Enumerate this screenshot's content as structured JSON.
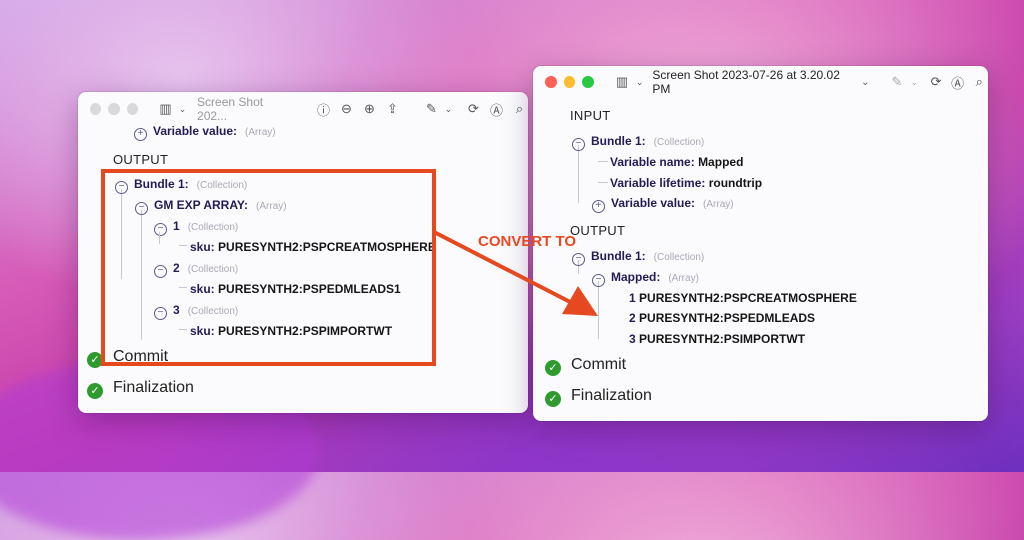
{
  "left_window": {
    "title": "Screen Shot 202...",
    "truncated_row": {
      "label": "Variable value:",
      "tag": "(Array)"
    },
    "output_label": "OUTPUT",
    "bundle": {
      "label": "Bundle 1:",
      "tag": "(Collection)"
    },
    "array": {
      "label": "GM EXP ARRAY:",
      "tag": "(Array)"
    },
    "items": [
      {
        "index": "1",
        "tag": "(Collection)",
        "key": "sku:",
        "value": "PURESYNTH2:PSPCREATMOSPHERE"
      },
      {
        "index": "2",
        "tag": "(Collection)",
        "key": "sku:",
        "value": "PURESYNTH2:PSPEDMLEADS1"
      },
      {
        "index": "3",
        "tag": "(Collection)",
        "key": "sku:",
        "value": "PURESYNTH2:PSPIMPORTWT"
      }
    ],
    "commit": "Commit",
    "finalization": "Finalization"
  },
  "right_window": {
    "title": "Screen Shot 2023-07-26 at 3.20.02 PM",
    "input_label": "INPUT",
    "input_bundle": {
      "label": "Bundle 1:",
      "tag": "(Collection)"
    },
    "variable_name": {
      "key": "Variable name:",
      "value": "Mapped"
    },
    "variable_lifetime": {
      "key": "Variable lifetime:",
      "value": "roundtrip"
    },
    "variable_value": {
      "key": "Variable value:",
      "tag": "(Array)"
    },
    "output_label": "OUTPUT",
    "output_bundle": {
      "label": "Bundle 1:",
      "tag": "(Collection)"
    },
    "mapped": {
      "label": "Mapped:",
      "tag": "(Array)"
    },
    "mapped_items": [
      {
        "index": "1",
        "value": "PURESYNTH2:PSPCREATMOSPHERE"
      },
      {
        "index": "2",
        "value": "PURESYNTH2:PSPEDMLEADS"
      },
      {
        "index": "3",
        "value": "PURESYNTH2:PSIMPORTWT"
      }
    ],
    "commit": "Commit",
    "finalization": "Finalization"
  },
  "annotation": {
    "label": "CONVERT TO",
    "color": "#e64820"
  },
  "icons": [
    "sidebar-icon",
    "info-icon",
    "zoom-out-icon",
    "zoom-in-icon",
    "share-icon",
    "markup-pen-icon",
    "rotate-icon",
    "annotate-icon",
    "search-icon",
    "check-icon"
  ]
}
